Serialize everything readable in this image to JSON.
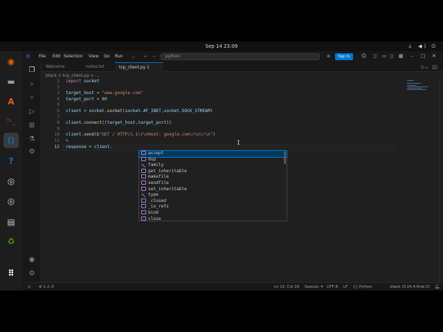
{
  "system": {
    "clock": "Sep 14  23:09"
  },
  "dock": [
    {
      "name": "firefox-icon",
      "glyph": "◉",
      "color": "#e66000"
    },
    {
      "name": "files-icon",
      "glyph": "▬",
      "color": "#9a9a9a"
    },
    {
      "name": "app-center-icon",
      "glyph": "A",
      "color": "#e95420"
    },
    {
      "name": "terminal-icon",
      "glyph": ">_",
      "color": "#5e2750"
    },
    {
      "name": "vscode-icon",
      "glyph": "⟨⟩",
      "color": "#0078d4"
    },
    {
      "name": "help-icon",
      "glyph": "?",
      "color": "#1f6fbf"
    },
    {
      "name": "disc-icon",
      "glyph": "◎",
      "color": "#cfcfcf"
    },
    {
      "name": "disc-icon-2",
      "glyph": "◎",
      "color": "#cfcfcf"
    },
    {
      "name": "drive-icon",
      "glyph": "▤",
      "color": "#cfcfcf"
    },
    {
      "name": "trash-icon",
      "glyph": "♻",
      "color": "#4e9a06"
    },
    {
      "name": "show-apps-icon",
      "glyph": "⠿",
      "color": "#ffffff"
    }
  ],
  "vscode": {
    "menu": [
      "File",
      "Edit",
      "Selection",
      "View",
      "Go",
      "Run",
      "..."
    ],
    "command_center": "python",
    "signin_label": "Sign In",
    "tabs": [
      {
        "label": "Welcome",
        "active": false
      },
      {
        "label": "notes.txt",
        "active": false
      },
      {
        "label": "tcp_client.py  1",
        "active": true
      }
    ],
    "breadcrumb": "black  >  tcp_client.py  >  ...",
    "code_lines": [
      {
        "n": "1",
        "html": "<span class='kw'>import</span> <span class='var'>socket</span>"
      },
      {
        "n": "2",
        "html": ""
      },
      {
        "n": "3",
        "html": "<span class='var'>target_host</span> = <span class='str'>\"www.google.com\"</span>"
      },
      {
        "n": "4",
        "html": "<span class='var'>target_port</span> = <span class='num'>80</span>"
      },
      {
        "n": "5",
        "html": ""
      },
      {
        "n": "6",
        "html": "<span class='var'>client</span> = <span class='var'>socket</span>.<span class='fn'>socket</span>(<span class='var'>socket</span>.<span class='var'>AF_INET</span>,<span class='var'>socket</span>.<span class='var'>SOCK_STREAM</span>)"
      },
      {
        "n": "7",
        "html": ""
      },
      {
        "n": "8",
        "html": "<span class='var'>client</span>.<span class='fn'>connect</span>((<span class='var'>target_host</span>,<span class='var'>target_port</span>))"
      },
      {
        "n": "9",
        "html": ""
      },
      {
        "n": "10",
        "html": "<span class='var'>client</span>.<span class='fn'>send</span>(<span class='var'>b</span><span class='str'>\"GET / HTTP/1.1\\r\\nHost: google.com\\r\\n\\r\\n\"</span>)"
      },
      {
        "n": "11",
        "html": "<span style='color:#e2c08d'>✎</span>"
      },
      {
        "n": "12",
        "html": "<span class='var'>response</span> = <span class='var'>client</span>."
      }
    ],
    "suggestions": [
      {
        "label": "accept",
        "kind": "method",
        "selected": true
      },
      {
        "label": "dup",
        "kind": "method",
        "selected": false
      },
      {
        "label": "family",
        "kind": "property",
        "selected": false
      },
      {
        "label": "get_inheritable",
        "kind": "method",
        "selected": false
      },
      {
        "label": "makefile",
        "kind": "method",
        "selected": false
      },
      {
        "label": "sendfile",
        "kind": "method",
        "selected": false
      },
      {
        "label": "set_inheritable",
        "kind": "method",
        "selected": false
      },
      {
        "label": "type",
        "kind": "property",
        "selected": false
      },
      {
        "label": "_closed",
        "kind": "method",
        "selected": false
      },
      {
        "label": "_io_refs",
        "kind": "method",
        "selected": false
      },
      {
        "label": "bind",
        "kind": "method",
        "selected": false
      },
      {
        "label": "close",
        "kind": "method",
        "selected": false
      }
    ],
    "status": {
      "errors": "⊗ 1 ⚠ 0",
      "ln_col": "Ln 12, Col 19",
      "spaces": "Spaces: 4",
      "encoding": "UTF-8",
      "eol": "LF",
      "language": "{} Python",
      "interpreter": "black (3.14.4.final.0)"
    }
  }
}
